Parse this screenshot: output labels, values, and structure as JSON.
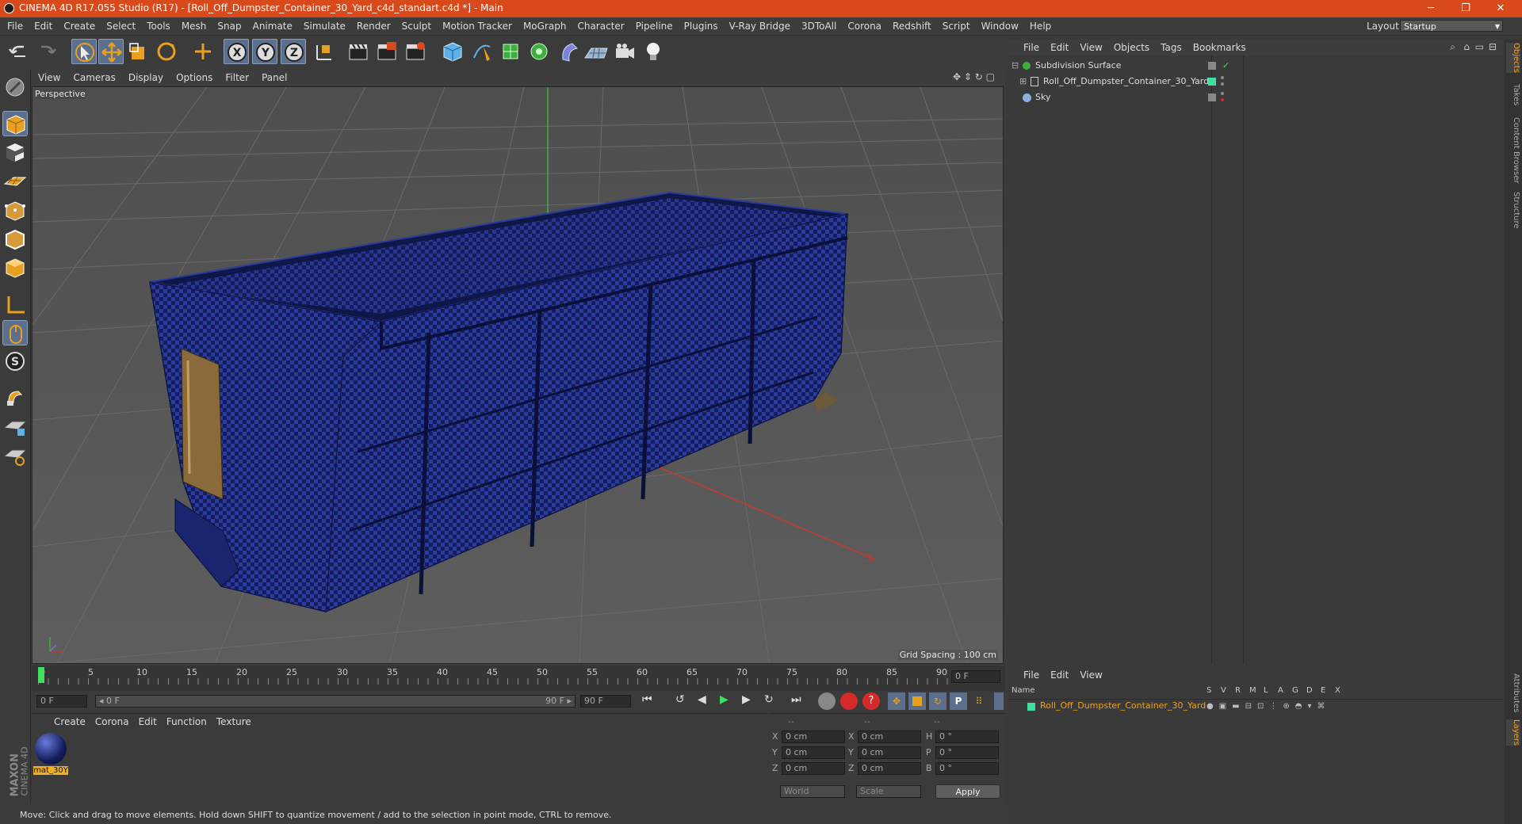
{
  "window": {
    "title": "CINEMA 4D R17.055 Studio (R17) - [Roll_Off_Dumpster_Container_30_Yard_c4d_standart.c4d *] - Main",
    "minimize": "─",
    "maximize": "❐",
    "close": "✕"
  },
  "menubar": {
    "items": [
      "File",
      "Edit",
      "Create",
      "Select",
      "Tools",
      "Mesh",
      "Snap",
      "Animate",
      "Simulate",
      "Render",
      "Sculpt",
      "Motion Tracker",
      "MoGraph",
      "Character",
      "Pipeline",
      "Plugins",
      "V-Ray Bridge",
      "3DToAll",
      "Corona",
      "Redshift",
      "Script",
      "Window",
      "Help"
    ],
    "layout_label": "Layout:",
    "layout_value": "Startup"
  },
  "viewport": {
    "menu": [
      "View",
      "Cameras",
      "Display",
      "Options",
      "Filter",
      "Panel"
    ],
    "label": "Perspective",
    "grid_spacing": "Grid Spacing : 100 cm",
    "accent_colors": {
      "container": "#1a2a78",
      "grid_line": "#4a4a4a",
      "x_axis": "#c43a2a",
      "y_axis": "#3fae3f"
    }
  },
  "timeline": {
    "ticks": [
      "0",
      "5",
      "10",
      "15",
      "20",
      "25",
      "30",
      "35",
      "40",
      "45",
      "50",
      "55",
      "60",
      "65",
      "70",
      "75",
      "80",
      "85",
      "90"
    ],
    "current_frame": "0 F",
    "start_field": "0 F",
    "range_start": "◂ 0 F",
    "range_end": "90 F ▸",
    "end_field": "90 F"
  },
  "materials": {
    "menu": [
      "Create",
      "Corona",
      "Edit",
      "Function",
      "Texture"
    ],
    "items": [
      {
        "name": "mat_30Y"
      }
    ]
  },
  "coordinates": {
    "headers": [
      "--",
      "--",
      "--"
    ],
    "rows": [
      {
        "a": "X",
        "av": "0 cm",
        "b": "X",
        "bv": "0 cm",
        "c": "H",
        "cv": "0 °"
      },
      {
        "a": "Y",
        "av": "0 cm",
        "b": "Y",
        "bv": "0 cm",
        "c": "P",
        "cv": "0 °"
      },
      {
        "a": "Z",
        "av": "0 cm",
        "b": "Z",
        "bv": "0 cm",
        "c": "B",
        "cv": "0 °"
      }
    ],
    "world": "World",
    "scale": "Scale",
    "apply": "Apply"
  },
  "status": "Move: Click and drag to move elements. Hold down SHIFT to quantize movement / add to the selection in point mode, CTRL to remove.",
  "objects": {
    "menu": [
      "File",
      "Edit",
      "View",
      "Objects",
      "Tags",
      "Bookmarks"
    ],
    "rows": [
      {
        "name": "Subdivision Surface"
      },
      {
        "name": "Roll_Off_Dumpster_Container_30_Yard"
      },
      {
        "name": "Sky"
      }
    ]
  },
  "layers": {
    "menu": [
      "File",
      "Edit",
      "View"
    ],
    "columns": [
      "Name",
      "S",
      "V",
      "R",
      "M",
      "L",
      "A",
      "G",
      "D",
      "E",
      "X"
    ],
    "rows": [
      {
        "name": "Roll_Off_Dumpster_Container_30_Yard"
      }
    ]
  },
  "right_tabs": [
    "Objects",
    "Takes",
    "Content Browser",
    "Structure",
    "Attributes",
    "Layers"
  ],
  "brand": {
    "maxon": "MAXON",
    "c4d": "CINEMA 4D"
  }
}
